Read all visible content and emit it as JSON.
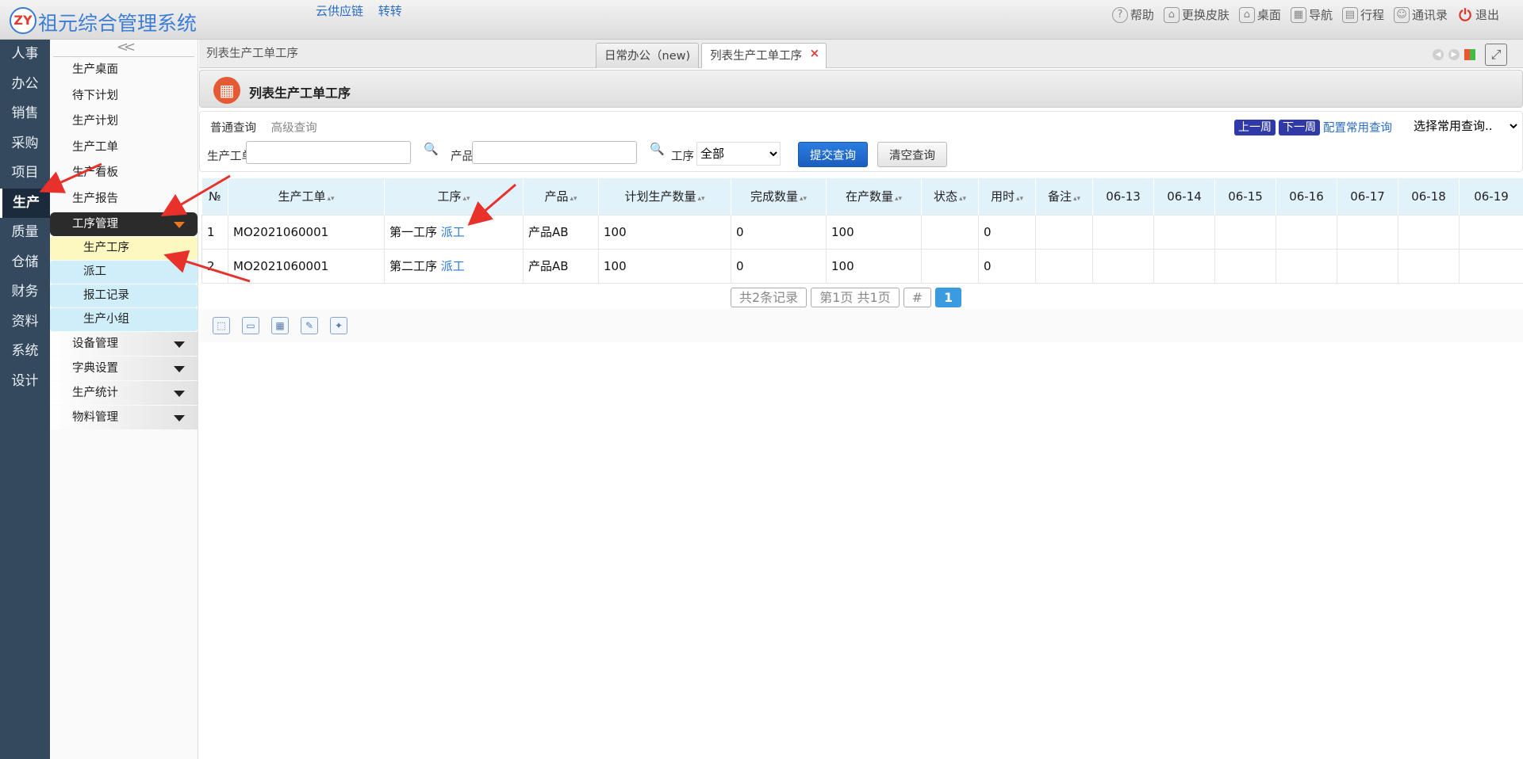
{
  "header": {
    "logo_text": "ZY",
    "app_title": "祖元综合管理系统",
    "links": [
      "云供应链",
      "转转"
    ],
    "toolbar": [
      {
        "label": "帮助",
        "icon": "help-icon"
      },
      {
        "label": "更换皮肤",
        "icon": "shirt-icon"
      },
      {
        "label": "桌面",
        "icon": "home-icon"
      },
      {
        "label": "导航",
        "icon": "grid-icon"
      },
      {
        "label": "行程",
        "icon": "calendar-icon"
      },
      {
        "label": "通讯录",
        "icon": "contact-icon"
      },
      {
        "label": "退出",
        "icon": "power-icon"
      }
    ]
  },
  "main_nav": [
    "人事",
    "办公",
    "销售",
    "采购",
    "项目",
    "生产",
    "质量",
    "仓储",
    "财务",
    "资料",
    "系统",
    "设计"
  ],
  "main_nav_active": "生产",
  "sub_nav": {
    "collapse_label": "<<",
    "items": [
      "生产桌面",
      "待下计划",
      "生产计划",
      "生产工单",
      "生产看板",
      "生产报告"
    ],
    "open_group": "工序管理",
    "open_children": [
      "生产工序",
      "派工",
      "报工记录",
      "生产小组"
    ],
    "active_child": "生产工序",
    "groups": [
      "设备管理",
      "字典设置",
      "生产统计",
      "物料管理"
    ]
  },
  "tabbar": {
    "breadcrumb": "列表生产工单工序",
    "tabs": [
      "日常办公（new)",
      "列表生产工单工序"
    ],
    "close_glyph": "×"
  },
  "page": {
    "title": "列表生产工单工序",
    "icon": "table-icon"
  },
  "search": {
    "mode_normal": "普通查询",
    "mode_advanced": "高级查询",
    "prev_week": "上一周",
    "next_week": "下一周",
    "config_link": "配置常用查询",
    "saved_query": "选择常用查询..",
    "order_label": "生产工单",
    "order_value": "",
    "product_label": "产品",
    "product_value": "",
    "op_label": "工序",
    "op_value": "全部",
    "submit": "提交查询",
    "clear": "清空查询"
  },
  "table": {
    "columns": [
      "№",
      "生产工单",
      "工序",
      "产品",
      "计划生产数量",
      "完成数量",
      "在产数量",
      "状态",
      "用时",
      "备注",
      "06-13",
      "06-14",
      "06-15",
      "06-16",
      "06-17",
      "06-18",
      "06-19"
    ],
    "rows": [
      {
        "no": "1",
        "order": "MO2021060001",
        "op": "第一工序",
        "link": "派工",
        "product": "产品AB",
        "planned": "100",
        "done": "0",
        "wip": "100",
        "status": "",
        "time": "0",
        "remark": ""
      },
      {
        "no": "2",
        "order": "MO2021060001",
        "op": "第二工序",
        "link": "派工",
        "product": "产品AB",
        "planned": "100",
        "done": "0",
        "wip": "100",
        "status": "",
        "time": "0",
        "remark": ""
      }
    ]
  },
  "pager": {
    "total": "共2条记录",
    "page_info": "第1页 共1页",
    "jump": "#",
    "current": "1"
  },
  "colors": {
    "accent": "#2b7de0",
    "nav_bg": "#34495e",
    "arrow": "#e8312a"
  }
}
